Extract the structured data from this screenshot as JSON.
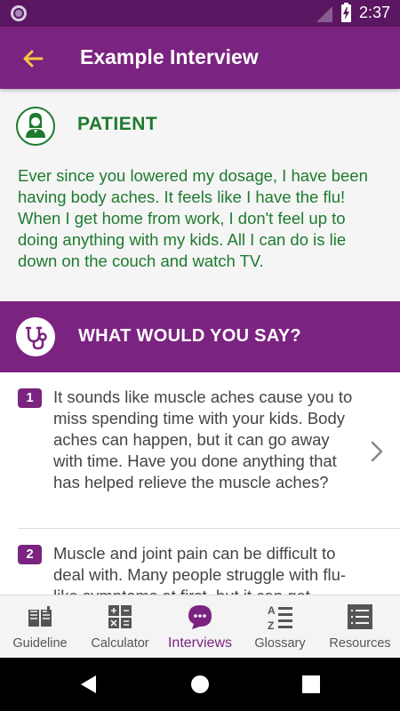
{
  "status_bar": {
    "time": "2:37"
  },
  "app_bar": {
    "title": "Example Interview"
  },
  "patient": {
    "label": "PATIENT",
    "quote": "Ever since you lowered my dosage, I have been having body aches. It feels like I have the flu! When I get home from work, I don't feel up to doing anything with my kids. All I can do is lie down on the couch and watch TV."
  },
  "question": {
    "title": "WHAT WOULD YOU SAY?"
  },
  "options": [
    {
      "number": "1",
      "text": "It sounds like muscle aches cause you to miss spending time with your kids. Body aches can happen, but it can go away with time. Have you done anything that has helped relieve the muscle aches?"
    },
    {
      "number": "2",
      "text": "Muscle and joint pain can be difficult to deal with. Many people struggle with flu-like symptoms at first, but it can get"
    }
  ],
  "bottom_nav": {
    "active": "Interviews",
    "items": [
      {
        "label": "Guideline",
        "icon": "book-icon"
      },
      {
        "label": "Calculator",
        "icon": "calculator-icon"
      },
      {
        "label": "Interviews",
        "icon": "chat-bubble-icon"
      },
      {
        "label": "Glossary",
        "icon": "a-z-list-icon"
      },
      {
        "label": "Resources",
        "icon": "list-icon"
      }
    ]
  },
  "colors": {
    "primary": "#7b2380",
    "status_bar": "#5a1660",
    "patient_green": "#1e7a2e",
    "back_arrow": "#f5c842",
    "patient_background": "#f5f5f5"
  }
}
